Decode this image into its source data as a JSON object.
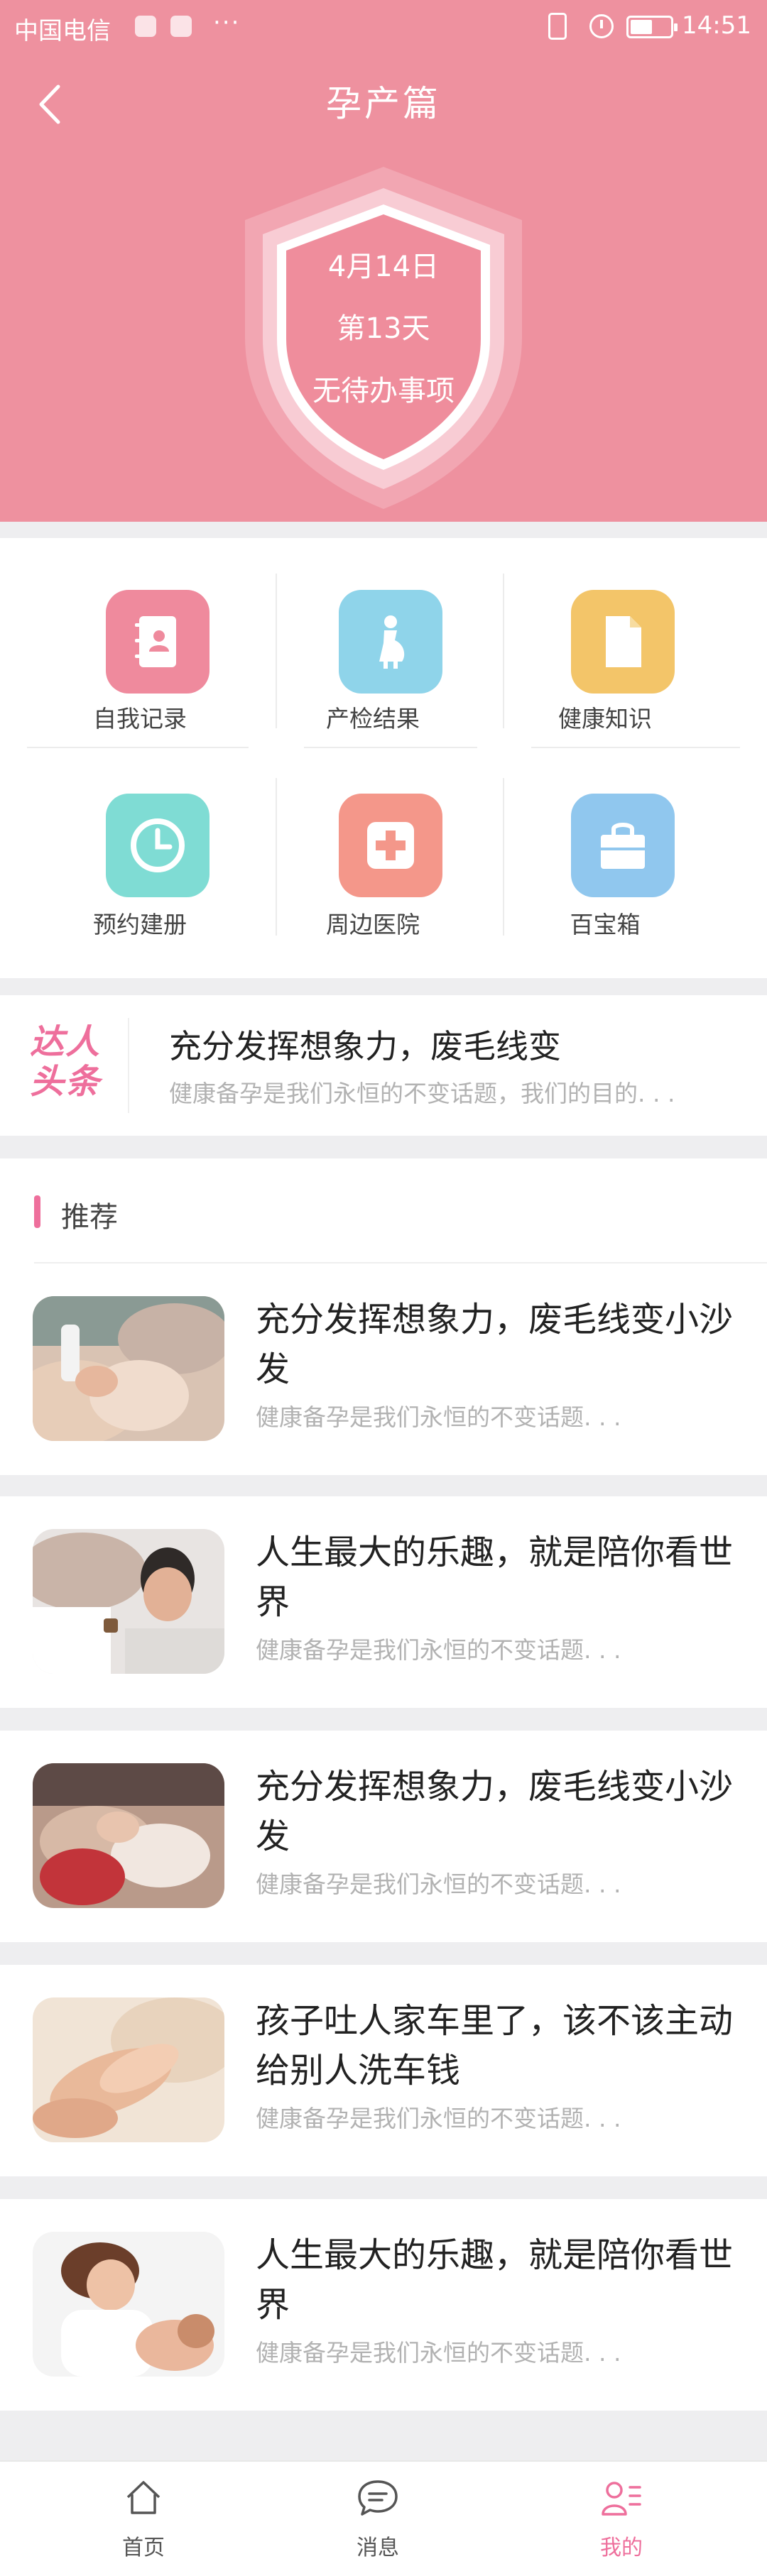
{
  "status_bar": {
    "carrier": "中国电信",
    "more": "···",
    "time": "14:51"
  },
  "nav": {
    "title": "孕产篇"
  },
  "shield": {
    "date": "4月14日",
    "day": "第13天",
    "todo": "无待办事项"
  },
  "grid": [
    {
      "label": "自我记录",
      "icon": "contact-book-icon",
      "color": "#ef8a9d"
    },
    {
      "label": "产检结果",
      "icon": "pregnant-woman-icon",
      "color": "#8fd4ea"
    },
    {
      "label": "健康知识",
      "icon": "document-icon",
      "color": "#f3c569"
    },
    {
      "label": "预约建册",
      "icon": "clock-icon",
      "color": "#7fdcd4"
    },
    {
      "label": "周边医院",
      "icon": "hospital-cross-icon",
      "color": "#f4978a"
    },
    {
      "label": "百宝箱",
      "icon": "shopping-bag-icon",
      "color": "#90c7ee"
    }
  ],
  "headline": {
    "logo": "达人头条",
    "title": "充分发挥想象力，废毛线变",
    "subtitle": "健康备孕是我们永恒的不变话题，我们的目的. . ."
  },
  "recommend": {
    "title": "推荐",
    "articles": [
      {
        "title": "充分发挥想象力，废毛线变小沙发",
        "subtitle": "健康备孕是我们永恒的不变话题. . ."
      },
      {
        "title": "人生最大的乐趣，就是陪你看世界",
        "subtitle": "健康备孕是我们永恒的不变话题. . ."
      },
      {
        "title": "充分发挥想象力，废毛线变小沙发",
        "subtitle": "健康备孕是我们永恒的不变话题. . ."
      },
      {
        "title": "孩子吐人家车里了，该不该主动给别人洗车钱",
        "subtitle": "健康备孕是我们永恒的不变话题. . ."
      },
      {
        "title": "人生最大的乐趣，就是陪你看世界",
        "subtitle": "健康备孕是我们永恒的不变话题. . ."
      }
    ]
  },
  "tabbar": {
    "tabs": [
      {
        "label": "首页",
        "icon": "home-icon"
      },
      {
        "label": "消息",
        "icon": "message-icon"
      },
      {
        "label": "我的",
        "icon": "profile-list-icon",
        "active": true
      }
    ],
    "active_color": "#ee6f9c"
  },
  "colors": {
    "header": "#ee919f",
    "accent": "#ee6f9c"
  }
}
